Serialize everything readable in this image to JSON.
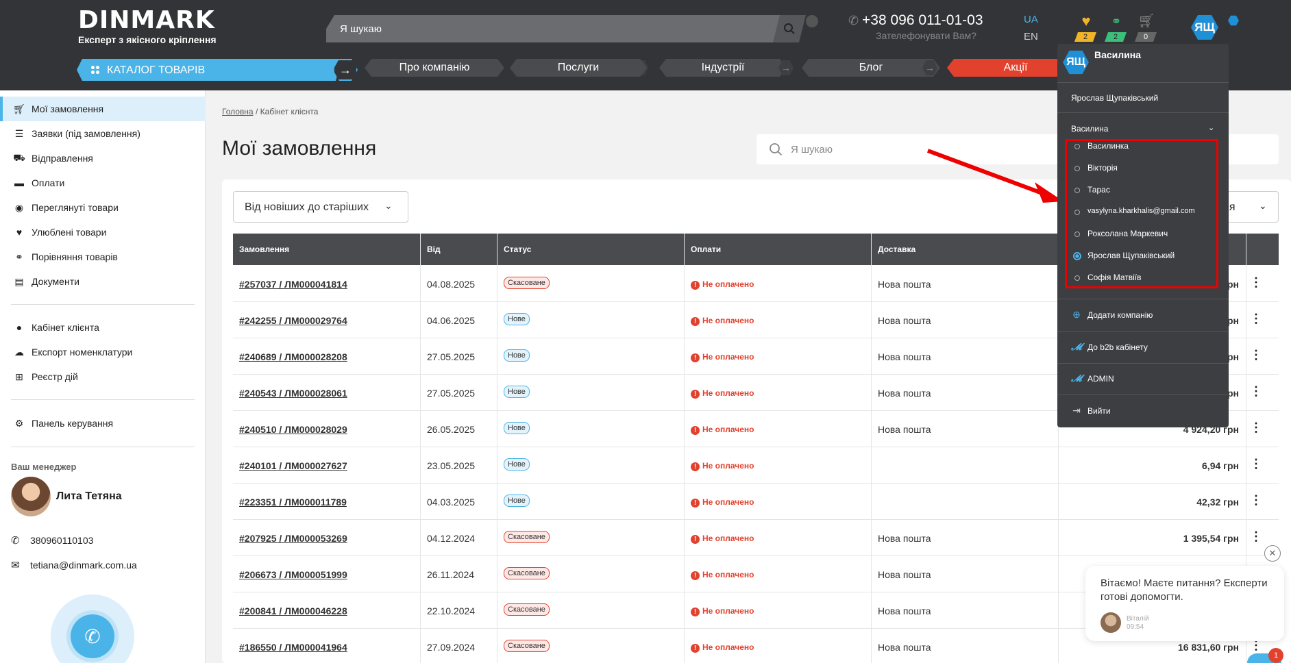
{
  "header": {
    "logo_word": "DINMARK",
    "logo_tagline": "Експерт з якісного кріплення",
    "search_placeholder": "Я шукаю",
    "phone": "+38 096 011-01-03",
    "callback": "Зателефонувати Вам?",
    "lang_active": "UA",
    "lang_other": "EN",
    "favorites_count": "2",
    "compare_count": "2",
    "cart_count": "0",
    "avatar_initials": "ЯЩ"
  },
  "nav": {
    "catalog": "КАТАЛОГ ТОВАРІВ",
    "items": [
      "Про компанію",
      "Послуги",
      "Індустрії",
      "Блог",
      "Акції"
    ]
  },
  "sidebar": {
    "items": [
      {
        "label": "Мої замовлення",
        "icon": "cart-icon"
      },
      {
        "label": "Заявки (під замовлення)",
        "icon": "list-icon"
      },
      {
        "label": "Відправлення",
        "icon": "truck-icon"
      },
      {
        "label": "Оплати",
        "icon": "card-icon"
      },
      {
        "label": "Переглянуті товари",
        "icon": "eye-icon"
      },
      {
        "label": "Улюблені товари",
        "icon": "heart-icon"
      },
      {
        "label": "Порівняння товарів",
        "icon": "compare-icon"
      },
      {
        "label": "Документи",
        "icon": "document-icon"
      },
      {
        "label": "Кабінет клієнта",
        "icon": "user-icon"
      },
      {
        "label": "Експорт номенклатури",
        "icon": "cloud-download-icon"
      },
      {
        "label": "Реєстр дій",
        "icon": "registry-icon"
      },
      {
        "label": "Панель керування",
        "icon": "user-settings-icon"
      }
    ],
    "manager_label": "Ваш менеджер",
    "manager_name": "Лита Тетяна",
    "manager_phone": "380960110103",
    "manager_email": "tetiana@dinmark.com.ua"
  },
  "main": {
    "breadcrumb_home": "Головна",
    "breadcrumb_current": "Кабінет клієнта",
    "title": "Мої замовлення",
    "search_placeholder": "Я шукаю",
    "sort_label": "Від новіших до старіших",
    "filter_label_fragment": "ня",
    "columns": [
      "Замовлення",
      "Від",
      "Статус",
      "Оплати",
      "Доставка"
    ],
    "orders": [
      {
        "num": "#257037 / ЛМ000041814",
        "date": "04.08.2025",
        "status": "Скасоване",
        "status_type": "cancel",
        "pay": "Не оплачено",
        "delivery": "Нова пошта",
        "sum": "грн"
      },
      {
        "num": "#242255 / ЛМ000029764",
        "date": "04.06.2025",
        "status": "Нове",
        "status_type": "new",
        "pay": "Не оплачено",
        "delivery": "Нова пошта",
        "sum": "грн"
      },
      {
        "num": "#240689 / ЛМ000028208",
        "date": "27.05.2025",
        "status": "Нове",
        "status_type": "new",
        "pay": "Не оплачено",
        "delivery": "Нова пошта",
        "sum": "грн"
      },
      {
        "num": "#240543 / ЛМ000028061",
        "date": "27.05.2025",
        "status": "Нове",
        "status_type": "new",
        "pay": "Не оплачено",
        "delivery": "Нова пошта",
        "sum": "грн"
      },
      {
        "num": "#240510 / ЛМ000028029",
        "date": "26.05.2025",
        "status": "Нове",
        "status_type": "new",
        "pay": "Не оплачено",
        "delivery": "Нова пошта",
        "sum": "4 924,20 грн"
      },
      {
        "num": "#240101 / ЛМ000027627",
        "date": "23.05.2025",
        "status": "Нове",
        "status_type": "new",
        "pay": "Не оплачено",
        "delivery": "",
        "sum": "6,94 грн"
      },
      {
        "num": "#223351 / ЛМ000011789",
        "date": "04.03.2025",
        "status": "Нове",
        "status_type": "new",
        "pay": "Не оплачено",
        "delivery": "",
        "sum": "42,32 грн"
      },
      {
        "num": "#207925 / ЛМ000053269",
        "date": "04.12.2024",
        "status": "Скасоване",
        "status_type": "cancel",
        "pay": "Не оплачено",
        "delivery": "Нова пошта",
        "sum": "1 395,54 грн"
      },
      {
        "num": "#206673 / ЛМ000051999",
        "date": "26.11.2024",
        "status": "Скасоване",
        "status_type": "cancel",
        "pay": "Не оплачено",
        "delivery": "Нова пошта",
        "sum": ""
      },
      {
        "num": "#200841 / ЛМ000046228",
        "date": "22.10.2024",
        "status": "Скасоване",
        "status_type": "cancel",
        "pay": "Не оплачено",
        "delivery": "Нова пошта",
        "sum": ""
      },
      {
        "num": "#186550 / ЛМ000041964",
        "date": "27.09.2024",
        "status": "Скасоване",
        "status_type": "cancel",
        "pay": "Не оплачено",
        "delivery": "Нова пошта",
        "sum": "16 831,60 грн"
      }
    ]
  },
  "dropdown": {
    "header_initials": "ЯЩ",
    "header_name": "Василина",
    "user_name": "Ярослав Щупаківський",
    "company_current": "Василина",
    "companies": [
      {
        "label": "Василинка",
        "selected": false
      },
      {
        "label": "Вікторія",
        "selected": false
      },
      {
        "label": "Тарас",
        "selected": false
      },
      {
        "label": "vasylyna.kharkhalis@gmail.com",
        "selected": false
      },
      {
        "label": "Роксолана Маркевич",
        "selected": false
      },
      {
        "label": "Ярослав Щупаківський",
        "selected": true
      },
      {
        "label": "Софія Матвіїв",
        "selected": false
      }
    ],
    "add_company": "Додати компанію",
    "b2b": "До b2b кабінету",
    "admin": "ADMIN",
    "logout": "Вийти"
  },
  "chat": {
    "message": "Вітаємо! Маєте питання? Експерти готові допомогти.",
    "agent": "Віталій",
    "time": "09:54",
    "badge": "1"
  },
  "colors": {
    "accent": "#4ab3e8",
    "header_bg": "#333437",
    "danger": "#e2412d",
    "annotation_red": "#e00000"
  }
}
